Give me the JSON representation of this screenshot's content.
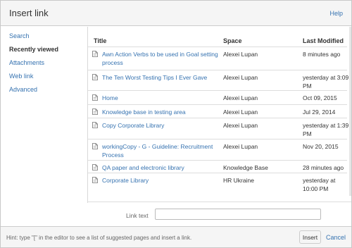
{
  "dialog": {
    "title": "Insert link",
    "help_label": "Help"
  },
  "sidebar": {
    "items": [
      {
        "label": "Search",
        "active": false
      },
      {
        "label": "Recently viewed",
        "active": true
      },
      {
        "label": "Attachments",
        "active": false
      },
      {
        "label": "Web link",
        "active": false
      },
      {
        "label": "Advanced",
        "active": false
      }
    ]
  },
  "table": {
    "columns": [
      "Title",
      "Space",
      "Last Modified"
    ],
    "rows": [
      {
        "title": "Awn Action Verbs to be used in Goal setting process",
        "space": "Alexei Lupan",
        "modified": "8 minutes ago",
        "icon": "page-icon"
      },
      {
        "title": "The Ten Worst Testing Tips I Ever Gave",
        "space": "Alexei Lupan",
        "modified": "yesterday at 3:09 PM",
        "icon": "page-icon"
      },
      {
        "title": "Home",
        "space": "Alexei Lupan",
        "modified": "Oct 09, 2015",
        "icon": "page-icon"
      },
      {
        "title": "Knowledge base in testing area",
        "space": "Alexei Lupan",
        "modified": "Jul 29, 2014",
        "icon": "page-icon"
      },
      {
        "title": "Copy Corporate Library",
        "space": "Alexei Lupan",
        "modified": "yesterday at 1:39 PM",
        "icon": "page-icon"
      },
      {
        "title": "workingCopy - G - Guideline: Recruitment Process",
        "space": "Alexei Lupan",
        "modified": "Nov 20, 2015",
        "icon": "page-icon"
      },
      {
        "title": "QA paper and electronic library",
        "space": "Knowledge Base",
        "modified": "28 minutes ago",
        "icon": "page-icon"
      },
      {
        "title": "Corporate Library",
        "space": "HR Ukraine",
        "modified": "yesterday at 10:00 PM",
        "icon": "page-icon"
      }
    ]
  },
  "link_text": {
    "label": "Link text",
    "value": ""
  },
  "footer": {
    "hint": "Hint: type \"[\" in the editor to see a list of suggested pages and insert a link.",
    "insert_label": "Insert",
    "cancel_label": "Cancel"
  },
  "colors": {
    "link": "#3572b0",
    "header_bg": "#f5f5f5"
  }
}
